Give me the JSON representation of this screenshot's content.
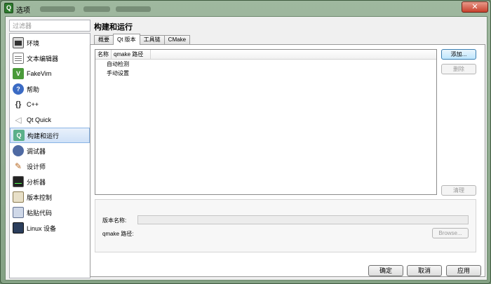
{
  "window": {
    "title": "选项",
    "app_icon": "qt-icon"
  },
  "filter": {
    "placeholder": "过滤器"
  },
  "sidebar": {
    "items": [
      {
        "label": "环境",
        "icon": "environment-icon"
      },
      {
        "label": "文本编辑器",
        "icon": "text-editor-icon"
      },
      {
        "label": "FakeVim",
        "icon": "fakevim-icon"
      },
      {
        "label": "帮助",
        "icon": "help-icon"
      },
      {
        "label": "C++",
        "icon": "cpp-icon"
      },
      {
        "label": "Qt Quick",
        "icon": "qt-quick-icon"
      },
      {
        "label": "构建和运行",
        "icon": "build-run-icon",
        "active": true
      },
      {
        "label": "调试器",
        "icon": "debugger-icon"
      },
      {
        "label": "设计师",
        "icon": "designer-icon"
      },
      {
        "label": "分析器",
        "icon": "analyzer-icon"
      },
      {
        "label": "版本控制",
        "icon": "version-control-icon"
      },
      {
        "label": "粘贴代码",
        "icon": "paste-code-icon"
      },
      {
        "label": "Linux 设备",
        "icon": "linux-device-icon"
      }
    ]
  },
  "page": {
    "title": "构建和运行"
  },
  "tabs": [
    {
      "label": "概要"
    },
    {
      "label": "Qt 版本",
      "active": true
    },
    {
      "label": "工具链"
    },
    {
      "label": "CMake"
    }
  ],
  "version_list": {
    "columns": [
      "名称",
      "qmake 路径"
    ],
    "rows": [
      "自动检测",
      "手动设置"
    ]
  },
  "buttons": {
    "add": "添加...",
    "remove": "删除",
    "clean": "清理",
    "browse": "Browse..."
  },
  "details": {
    "version_name_label": "版本名称:",
    "qmake_path_label": "qmake 路径:",
    "version_name_value": "",
    "qmake_path_value": ""
  },
  "dialog": {
    "ok": "确定",
    "cancel": "取消",
    "apply": "应用"
  },
  "colors": {
    "selection": "#cfe1f7",
    "frame": "#84a184"
  }
}
